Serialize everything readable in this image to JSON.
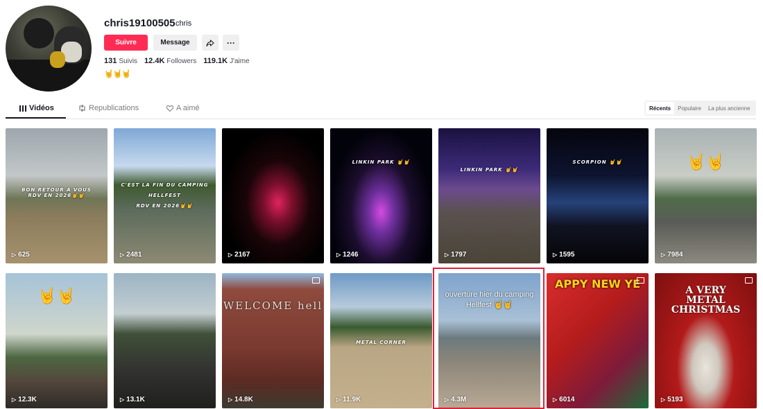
{
  "profile": {
    "username": "chris19100505",
    "nickname": "chris",
    "follow_label": "Suivre",
    "message_label": "Message",
    "more_label": "···",
    "following_count": "131",
    "following_label": "Suivis",
    "followers_count": "12.4K",
    "followers_label": "Followers",
    "likes_count": "119.1K",
    "likes_label": "J'aime",
    "bio": "🤘🤘🤘"
  },
  "tabs": [
    {
      "label": "Vidéos",
      "icon": "grid-icon"
    },
    {
      "label": "Republications",
      "icon": "repost-icon"
    },
    {
      "label": "A aimé",
      "icon": "heart-icon"
    }
  ],
  "sort": {
    "options": [
      "Récents",
      "Populaire",
      "La plus ancienne"
    ],
    "selected": "Récents"
  },
  "videos": [
    {
      "views": "625",
      "caption": "BON RETOUR À VOUS\nRDV EN 2026🤘🤘"
    },
    {
      "views": "2481",
      "caption": "C'EST LA FIN DU CAMPING\nHELLFEST\nRDV EN 2026🤘🤘"
    },
    {
      "views": "2167",
      "caption": ""
    },
    {
      "views": "1246",
      "caption": "LINKIN PARK 🤘🤘"
    },
    {
      "views": "1797",
      "caption": "LINKIN PARK 🤘🤘"
    },
    {
      "views": "1595",
      "caption": "SCORPION 🤘🤘"
    },
    {
      "views": "7984",
      "caption": "🤘🤘"
    },
    {
      "views": "12.3K",
      "caption": "🤘🤘"
    },
    {
      "views": "13.1K",
      "caption": ""
    },
    {
      "views": "14.8K",
      "caption": "WELCOME hell",
      "gallery": true
    },
    {
      "views": "11.9K",
      "caption": "METAL CORNER"
    },
    {
      "views": "4.3M",
      "caption": "ouverture hier du camping\nHellfest 🤘🤘"
    },
    {
      "views": "6014",
      "caption": "APPY NEW YE",
      "gallery": true
    },
    {
      "views": "5193",
      "caption": "A VERY\nMETAL CHRISTMAS",
      "gallery": true
    }
  ]
}
